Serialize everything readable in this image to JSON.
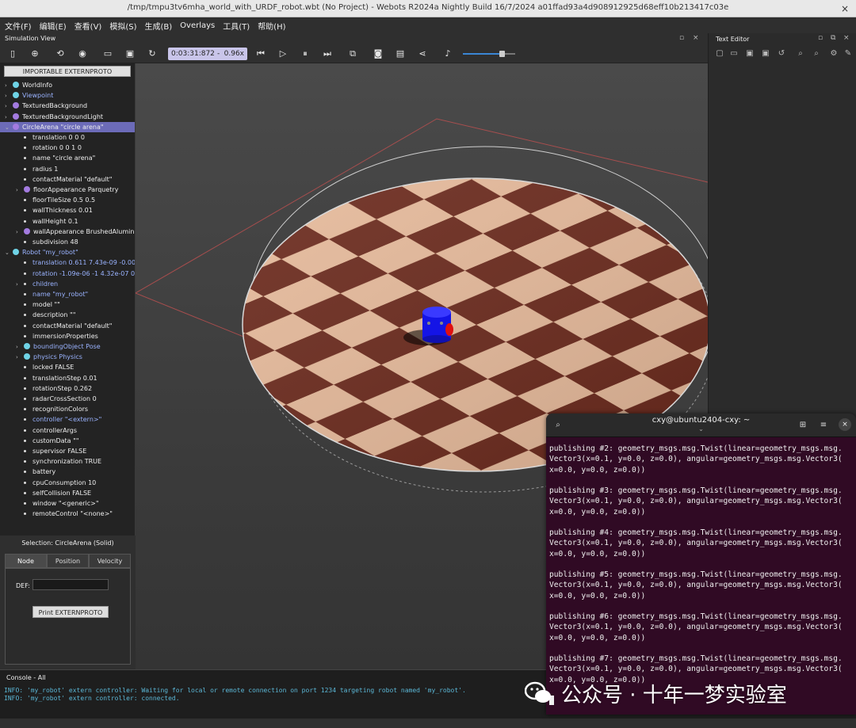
{
  "window": {
    "title": "/tmp/tmpu3tv6mha_world_with_URDF_robot.wbt (No Project) - Webots R2024a Nightly Build 16/7/2024 a01ffad93a4d908912925d68eff10b213417c03e",
    "close": "×"
  },
  "menu": [
    "文件(F)",
    "编辑(E)",
    "查看(V)",
    "模拟(S)",
    "生成(B)",
    "Overlays",
    "工具(T)",
    "帮助(H)"
  ],
  "sim_view": {
    "title": "Simulation View",
    "time": "0:03:31:872",
    "speed_sep": "-",
    "speed": "0.96x"
  },
  "text_editor": {
    "title": "Text Editor"
  },
  "scene_tree": {
    "proto_button": "IMPORTABLE EXTERNPROTO",
    "items": [
      {
        "indent": 0,
        "arrow": "›",
        "dot": "cyan",
        "label": "WorldInfo"
      },
      {
        "indent": 0,
        "arrow": "›",
        "dot": "cyan",
        "label": "Viewpoint",
        "blue": true
      },
      {
        "indent": 0,
        "arrow": "›",
        "dot": "purple",
        "label": "TexturedBackground"
      },
      {
        "indent": 0,
        "arrow": "›",
        "dot": "purple",
        "label": "TexturedBackgroundLight"
      },
      {
        "indent": 0,
        "arrow": "⌄",
        "dot": "purple",
        "label": "CircleArena \"circle arena\"",
        "selected": true
      },
      {
        "indent": 1,
        "label": "translation 0 0 0"
      },
      {
        "indent": 1,
        "label": "rotation 0 0 1 0"
      },
      {
        "indent": 1,
        "label": "name \"circle arena\""
      },
      {
        "indent": 1,
        "label": "radius 1"
      },
      {
        "indent": 1,
        "label": "contactMaterial \"default\""
      },
      {
        "indent": 1,
        "arrow": "›",
        "dot": "purple",
        "label": "floorAppearance Parquetry"
      },
      {
        "indent": 1,
        "label": "floorTileSize 0.5 0.5"
      },
      {
        "indent": 1,
        "label": "wallThickness 0.01"
      },
      {
        "indent": 1,
        "label": "wallHeight 0.1"
      },
      {
        "indent": 1,
        "arrow": "›",
        "dot": "purple",
        "label": "wallAppearance BrushedAluminium"
      },
      {
        "indent": 1,
        "label": "subdivision 48"
      },
      {
        "indent": 0,
        "arrow": "⌄",
        "dot": "cyan",
        "label": "Robot \"my_robot\"",
        "blue": true
      },
      {
        "indent": 1,
        "label": "translation 0.611 7.43e-09 -0.000",
        "blue": true
      },
      {
        "indent": 1,
        "label": "rotation -1.09e-06 -1 4.32e-07 0.",
        "blue": true
      },
      {
        "indent": 1,
        "arrow": "›",
        "label": "children",
        "blue": true
      },
      {
        "indent": 1,
        "label": "name \"my_robot\"",
        "blue": true
      },
      {
        "indent": 1,
        "label": "model \"\""
      },
      {
        "indent": 1,
        "label": "description \"\""
      },
      {
        "indent": 1,
        "label": "contactMaterial \"default\""
      },
      {
        "indent": 1,
        "label": "immersionProperties"
      },
      {
        "indent": 1,
        "arrow": "›",
        "dot": "cyan",
        "label": "boundingObject Pose",
        "blue": true
      },
      {
        "indent": 1,
        "arrow": "›",
        "dot": "cyan",
        "label": "physics Physics",
        "blue": true
      },
      {
        "indent": 1,
        "label": "locked FALSE"
      },
      {
        "indent": 1,
        "label": "translationStep 0.01"
      },
      {
        "indent": 1,
        "label": "rotationStep 0.262"
      },
      {
        "indent": 1,
        "label": "radarCrossSection 0"
      },
      {
        "indent": 1,
        "label": "recognitionColors"
      },
      {
        "indent": 1,
        "label": "controller \"<extern>\"",
        "blue": true
      },
      {
        "indent": 1,
        "label": "controllerArgs"
      },
      {
        "indent": 1,
        "label": "customData \"\""
      },
      {
        "indent": 1,
        "label": "supervisor FALSE"
      },
      {
        "indent": 1,
        "label": "synchronization TRUE"
      },
      {
        "indent": 1,
        "label": "battery"
      },
      {
        "indent": 1,
        "label": "cpuConsumption 10"
      },
      {
        "indent": 1,
        "label": "selfCollision FALSE"
      },
      {
        "indent": 1,
        "label": "window \"<generic>\""
      },
      {
        "indent": 1,
        "label": "remoteControl \"<none>\""
      }
    ]
  },
  "selection": {
    "title": "Selection: CircleArena (Solid)",
    "tabs": [
      "Node",
      "Position",
      "Velocity"
    ],
    "def_label": "DEF:",
    "def_value": "",
    "print_button": "Print EXTERNPROTO"
  },
  "console": {
    "title": "Console - All",
    "lines": [
      "INFO: 'my_robot' extern controller: Waiting for local or remote connection on port 1234 targeting robot named 'my_robot'.",
      "INFO: 'my_robot' extern controller: connected."
    ]
  },
  "terminal": {
    "title": "cxy@ubuntu2404-cxy: ~",
    "sub": "⌄",
    "blocks": [
      "publishing #2: geometry_msgs.msg.Twist(linear=geometry_msgs.msg.\nVector3(x=0.1, y=0.0, z=0.0), angular=geometry_msgs.msg.Vector3(\nx=0.0, y=0.0, z=0.0))",
      "publishing #3: geometry_msgs.msg.Twist(linear=geometry_msgs.msg.\nVector3(x=0.1, y=0.0, z=0.0), angular=geometry_msgs.msg.Vector3(\nx=0.0, y=0.0, z=0.0))",
      "publishing #4: geometry_msgs.msg.Twist(linear=geometry_msgs.msg.\nVector3(x=0.1, y=0.0, z=0.0), angular=geometry_msgs.msg.Vector3(\nx=0.0, y=0.0, z=0.0))",
      "publishing #5: geometry_msgs.msg.Twist(linear=geometry_msgs.msg.\nVector3(x=0.1, y=0.0, z=0.0), angular=geometry_msgs.msg.Vector3(\nx=0.0, y=0.0, z=0.0))",
      "publishing #6: geometry_msgs.msg.Twist(linear=geometry_msgs.msg.\nVector3(x=0.1, y=0.0, z=0.0), angular=geometry_msgs.msg.Vector3(\nx=0.0, y=0.0, z=0.0))",
      "publishing #7: geometry_msgs.msg.Twist(linear=geometry_msgs.msg.\nVector3(x=0.1, y=0.0, z=0.0), angular=geometry_msgs.msg.Vector3(\nx=0.0, y=0.0, z=0.0))"
    ]
  },
  "watermark": {
    "text": "公众号 · 十年一梦实验室"
  },
  "colors": {
    "tile_dark": "#6b2a1d",
    "tile_light": "#e8bd9f",
    "robot": "#1a1aff",
    "terminal_bg": "#300a24",
    "selection": "#6c6bb8"
  }
}
